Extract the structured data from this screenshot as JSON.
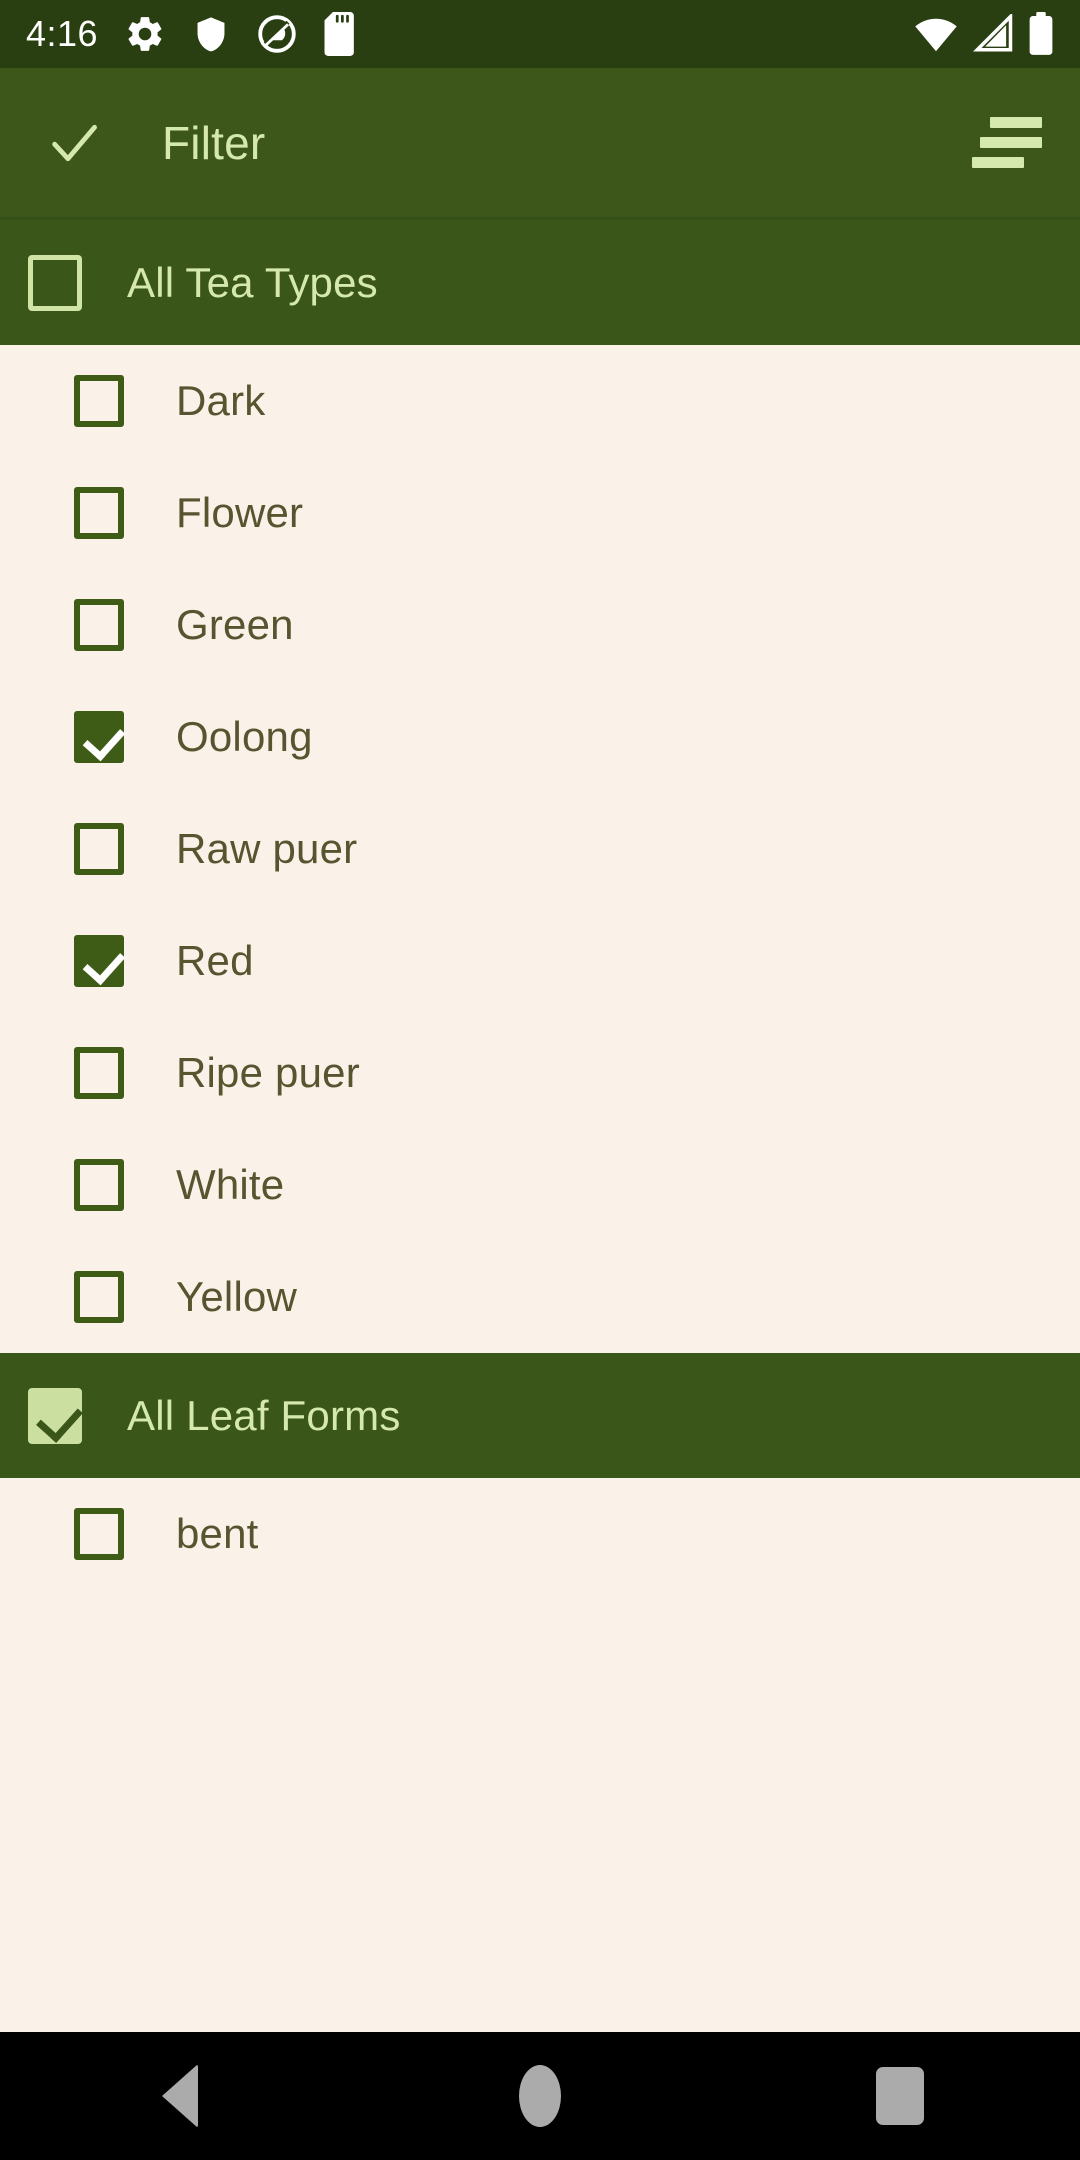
{
  "status_bar": {
    "time": "4:16",
    "left_icons": [
      {
        "name": "gear-icon"
      },
      {
        "name": "shield-icon"
      },
      {
        "name": "android-q-logo-icon"
      },
      {
        "name": "sd-card-icon"
      }
    ],
    "right_icons": [
      {
        "name": "wifi-icon"
      },
      {
        "name": "cellular-signal-icon"
      },
      {
        "name": "battery-icon"
      }
    ],
    "background_color": "#2A3F11",
    "foreground_color": "#FFFFFF"
  },
  "app_bar": {
    "confirm_icon": "check-icon",
    "title": "Filter",
    "menu_icon": "sort-lines-icon",
    "background_color": "#3C5719",
    "text_color": "#D5E8AE"
  },
  "sections": [
    {
      "header": {
        "label": "All Tea Types",
        "checked": false
      },
      "items": [
        {
          "label": "Dark",
          "checked": false
        },
        {
          "label": "Flower",
          "checked": false
        },
        {
          "label": "Green",
          "checked": false
        },
        {
          "label": "Oolong",
          "checked": true
        },
        {
          "label": "Raw puer",
          "checked": false
        },
        {
          "label": "Red",
          "checked": true
        },
        {
          "label": "Ripe puer",
          "checked": false
        },
        {
          "label": "White",
          "checked": false
        },
        {
          "label": "Yellow",
          "checked": false
        }
      ]
    },
    {
      "header": {
        "label": "All Leaf Forms",
        "checked": true
      },
      "items": [
        {
          "label": "bent",
          "checked": false
        }
      ]
    }
  ],
  "nav_bar": {
    "back_label": "back-button",
    "home_label": "home-button",
    "recents_label": "recents-button",
    "background_color": "#000000",
    "icon_color": "#ABABAB"
  },
  "theme": {
    "list_background": "#FAF1E9",
    "section_green": "#3A5619",
    "accent_green": "#3F5C16",
    "light_green": "#D5E8AE",
    "item_text": "#57552F"
  }
}
